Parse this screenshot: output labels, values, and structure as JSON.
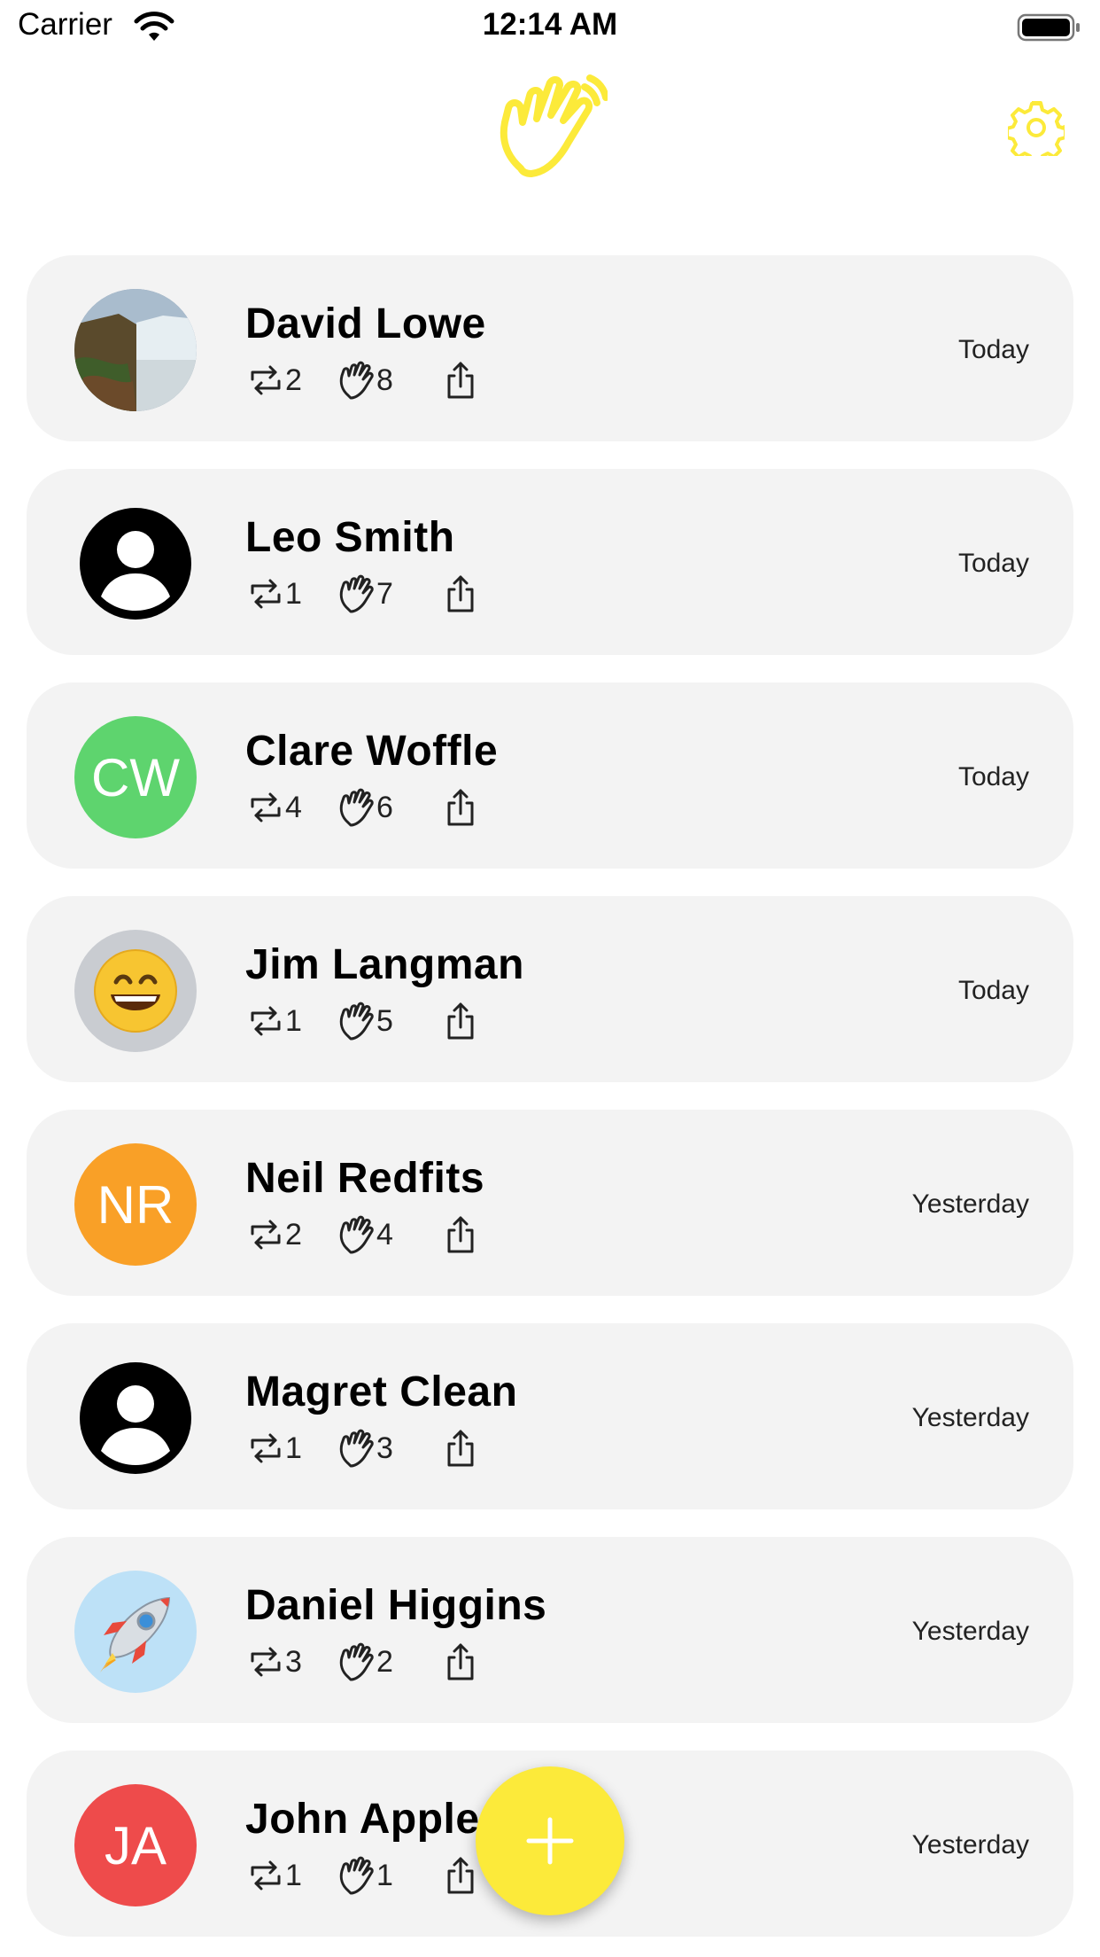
{
  "status_bar": {
    "carrier": "Carrier",
    "time": "12:14 AM"
  },
  "header": {
    "logo_icon": "waving-hand-icon",
    "settings_icon": "gear-icon",
    "accent_color": "#FCEA3A"
  },
  "contacts": [
    {
      "name": "David Lowe",
      "reposts": "2",
      "waves": "8",
      "date": "Today",
      "avatar": {
        "type": "photo",
        "icon": "waterfall-photo"
      }
    },
    {
      "name": "Leo Smith",
      "reposts": "1",
      "waves": "7",
      "date": "Today",
      "avatar": {
        "type": "placeholder",
        "icon": "person-icon"
      }
    },
    {
      "name": "Clare Woffle",
      "reposts": "4",
      "waves": "6",
      "date": "Today",
      "avatar": {
        "type": "initials",
        "initials": "CW",
        "color": "#5ED46E"
      }
    },
    {
      "name": "Jim Langman",
      "reposts": "1",
      "waves": "5",
      "date": "Today",
      "avatar": {
        "type": "emoji",
        "icon": "grinning-face-emoji",
        "color": "#C9CCD1"
      }
    },
    {
      "name": "Neil Redfits",
      "reposts": "2",
      "waves": "4",
      "date": "Yesterday",
      "avatar": {
        "type": "initials",
        "initials": "NR",
        "color": "#F9A027"
      }
    },
    {
      "name": "Magret Clean",
      "reposts": "1",
      "waves": "3",
      "date": "Yesterday",
      "avatar": {
        "type": "placeholder",
        "icon": "person-icon"
      }
    },
    {
      "name": "Daniel Higgins",
      "reposts": "3",
      "waves": "2",
      "date": "Yesterday",
      "avatar": {
        "type": "emoji",
        "icon": "rocket-emoji",
        "color": "#BDE1F7"
      }
    },
    {
      "name": "John Apple",
      "reposts": "1",
      "waves": "1",
      "date": "Yesterday",
      "avatar": {
        "type": "initials",
        "initials": "JA",
        "color": "#EE4B4B"
      }
    }
  ],
  "fab": {
    "icon": "plus-icon"
  }
}
